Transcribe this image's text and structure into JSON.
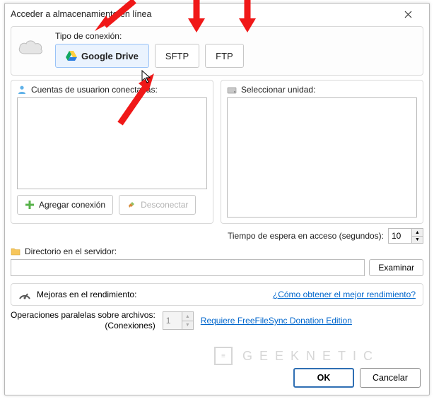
{
  "title": "Acceder a almacenamiento en línea",
  "connection": {
    "label": "Tipo de conexión:",
    "google_drive": "Google Drive",
    "sftp": "SFTP",
    "ftp": "FTP"
  },
  "accounts": {
    "header": "Cuentas de usuarion conectadas:",
    "add": "Agregar conexión",
    "disconnect": "Desconectar"
  },
  "drives": {
    "header": "Seleccionar unidad:"
  },
  "timeout": {
    "label": "Tiempo de espera en acceso (segundos):",
    "value": "10"
  },
  "directory": {
    "label": "Directorio en el servidor:",
    "value": "",
    "browse": "Examinar"
  },
  "performance": {
    "label": "Mejoras en el rendimiento:",
    "link": "¿Cómo obtener el mejor rendimiento?"
  },
  "parops": {
    "label1": "Operaciones paralelas sobre archivos:",
    "label2": "(Conexiones)",
    "value": "1",
    "link": "Requiere FreeFileSync Donation Edition"
  },
  "footer": {
    "ok": "OK",
    "cancel": "Cancelar"
  },
  "watermark": "GEEKNETIC"
}
